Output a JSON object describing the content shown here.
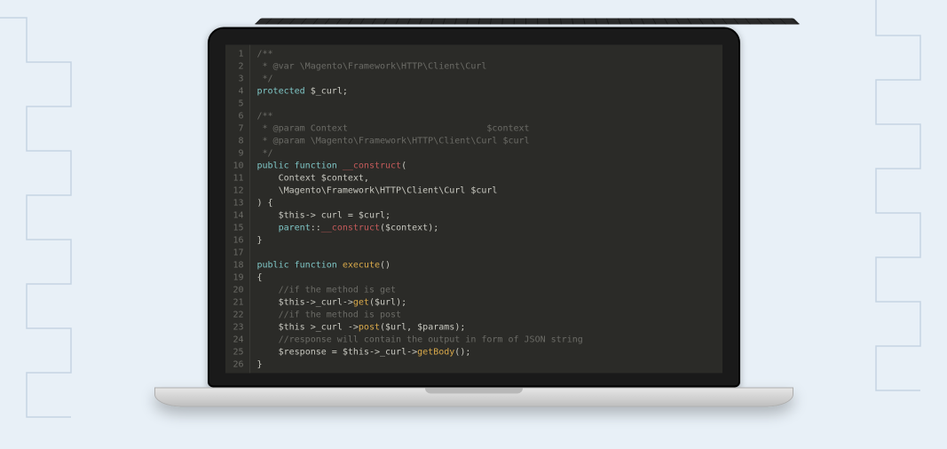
{
  "code": {
    "lines": [
      {
        "n": 1,
        "cls": "c-comment",
        "text": "/**"
      },
      {
        "n": 2,
        "cls": "c-comment",
        "text": " * @var \\Magento\\Framework\\HTTP\\Client\\Curl"
      },
      {
        "n": 3,
        "cls": "c-comment",
        "text": " */"
      },
      {
        "n": 4,
        "cls": "",
        "html": "<span class='c-keyword'>protected</span> <span class='c-var'>$_curl;</span>"
      },
      {
        "n": 5,
        "cls": "",
        "text": ""
      },
      {
        "n": 6,
        "cls": "c-comment",
        "text": "/**"
      },
      {
        "n": 7,
        "cls": "c-comment",
        "text": " * @param Context                          $context"
      },
      {
        "n": 8,
        "cls": "c-comment",
        "text": " * @param \\Magento\\Framework\\HTTP\\Client\\Curl $curl"
      },
      {
        "n": 9,
        "cls": "c-comment",
        "text": " */"
      },
      {
        "n": 10,
        "cls": "",
        "html": "<span class='c-keyword'>public function</span> <span class='c-special'>__construct</span>("
      },
      {
        "n": 11,
        "cls": "",
        "html": "    <span class='c-var'>Context $context,</span>"
      },
      {
        "n": 12,
        "cls": "",
        "html": "    <span class='c-var'>\\Magento\\Framework\\HTTP\\Client\\Curl $curl</span>"
      },
      {
        "n": 13,
        "cls": "",
        "text": ") {"
      },
      {
        "n": 14,
        "cls": "",
        "html": "    <span class='c-var'>$this-&gt; curl = $curl;</span>"
      },
      {
        "n": 15,
        "cls": "",
        "html": "    <span class='c-keyword'>parent</span>::<span class='c-special'>__construct</span>(<span class='c-var'>$context</span>);"
      },
      {
        "n": 16,
        "cls": "",
        "text": "}"
      },
      {
        "n": 17,
        "cls": "",
        "text": ""
      },
      {
        "n": 18,
        "cls": "",
        "html": "<span class='c-keyword'>public function</span> <span class='c-func'>execute</span>()"
      },
      {
        "n": 19,
        "cls": "",
        "text": "{"
      },
      {
        "n": 20,
        "cls": "c-comment",
        "text": "    //if the method is get"
      },
      {
        "n": 21,
        "cls": "",
        "html": "    <span class='c-var'>$this-&gt;_curl-&gt;</span><span class='c-func'>get</span>(<span class='c-var'>$url</span>);"
      },
      {
        "n": 22,
        "cls": "c-comment",
        "text": "    //if the method is post"
      },
      {
        "n": 23,
        "cls": "",
        "html": "    <span class='c-var'>$this &gt;_curl -&gt;</span><span class='c-func'>post</span>(<span class='c-var'>$url, $params</span>);"
      },
      {
        "n": 24,
        "cls": "c-comment",
        "text": "    //response will contain the output in form of JSON string"
      },
      {
        "n": 25,
        "cls": "",
        "html": "    <span class='c-var'>$response = $this-&gt;_curl-&gt;</span><span class='c-func'>getBody</span>();"
      },
      {
        "n": 26,
        "cls": "",
        "text": "}"
      }
    ]
  }
}
